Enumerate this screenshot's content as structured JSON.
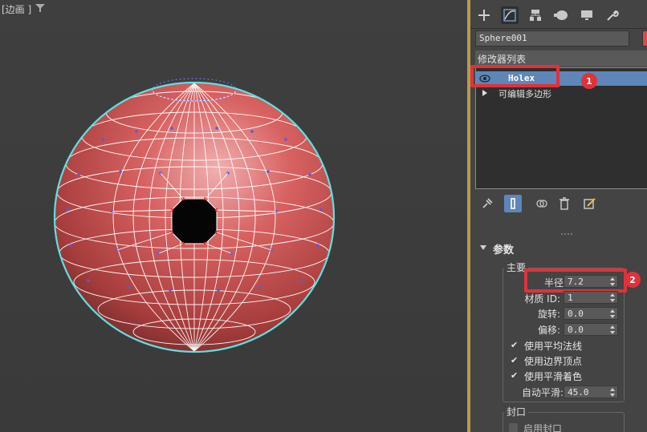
{
  "viewport": {
    "label": "[边画 ]"
  },
  "command_panel": {
    "tabs": [
      "create-tab",
      "modify-tab",
      "hierarchy-tab",
      "motion-tab",
      "display-tab",
      "utilities-tab"
    ],
    "object_name": "Sphere001",
    "object_color": "#d94a4a",
    "modifier_list_label": "修改器列表",
    "stack": [
      {
        "label": "Holex",
        "selected": true
      },
      {
        "label": "可编辑多边形",
        "selected": false
      }
    ],
    "annotations": {
      "badge1": "1",
      "badge2": "2"
    },
    "rollout": {
      "title": "参数",
      "main_group_label": "主要",
      "radius_label": "半径:",
      "radius_value": "7.2",
      "material_id_label": "材质 ID:",
      "material_id_value": "1",
      "rotate_label": "旋转:",
      "rotate_value": "0.0",
      "offset_label": "偏移:",
      "offset_value": "0.0",
      "use_avg_normals": "使用平均法线",
      "use_edge_verts": "使用边界顶点",
      "use_smooth_shading": "使用平滑着色",
      "auto_smooth_label": "自动平滑:",
      "auto_smooth_value": "45.0",
      "cap_group_label": "封口",
      "cap_option": "启用封口"
    }
  },
  "colors": {
    "sphere": "#c84a4a",
    "wire": "#ffffff",
    "selection_outline": "#5fe0e0",
    "highlight_box": "#e0323a",
    "selected_row": "#5e86b8",
    "viewport_border": "#b89a4f"
  }
}
